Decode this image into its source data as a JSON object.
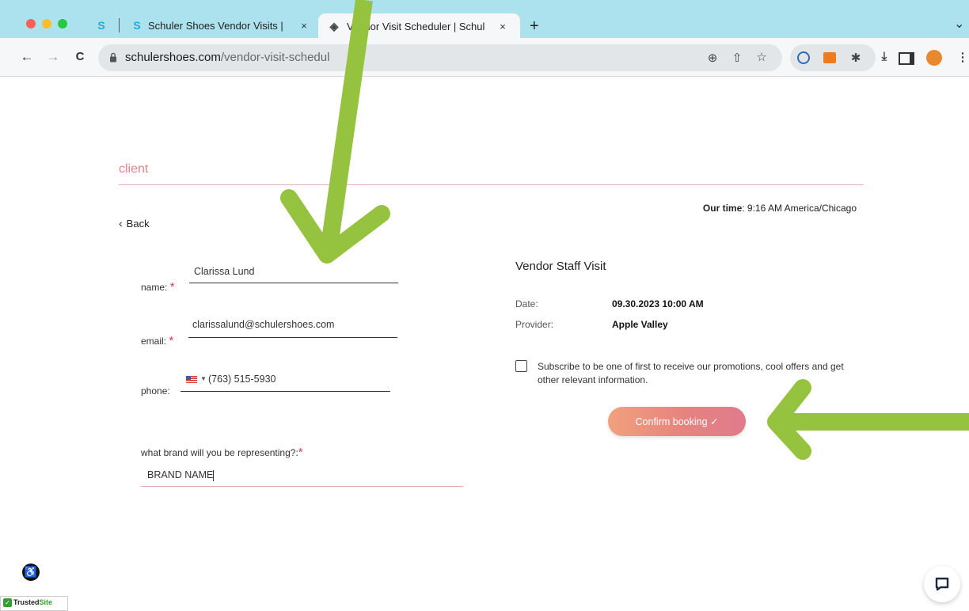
{
  "browser": {
    "tabs": [
      {
        "favicon": "S",
        "title": "",
        "close": ""
      },
      {
        "favicon": "S",
        "title": "Schuler Shoes Vendor Visits |",
        "close": "×"
      },
      {
        "favicon": "◈",
        "title": "Vendor Visit Scheduler | Schul",
        "close": "×"
      }
    ],
    "new_tab": "+",
    "tab_menu": "⌄",
    "nav": {
      "back": "←",
      "forward": "→",
      "reload": "C"
    },
    "url_domain": "schulershoes.com",
    "url_path": "/vendor-visit-schedul"
  },
  "page": {
    "brand": "client",
    "our_time_label": "Our time",
    "our_time_value": ": 9:16 AM America/Chicago",
    "back": "Back",
    "form": {
      "name_label": "name:",
      "name_value": "Clarissa Lund",
      "email_label": "email:",
      "email_value": "clarissalund@schulershoes.com",
      "phone_label": "phone:",
      "phone_value": "(763) 515-5930",
      "brand_label": "what brand will you be representing?:",
      "brand_value": "BRAND NAME",
      "required_mark": "*"
    },
    "summary": {
      "title": "Vendor Staff Visit",
      "date_label": "Date:",
      "date_value": "09.30.2023 10:00 AM",
      "provider_label": "Provider:",
      "provider_value": "Apple Valley"
    },
    "subscribe_text": "Subscribe to be one of first to receive our promotions, cool offers and get other relevant information.",
    "confirm_label": "Confirm booking ✓",
    "trusted_site": "Trusted",
    "trusted_site_suffix": "Site"
  },
  "colors": {
    "tab_bar": "#abe2ee",
    "accent_pink": "#e5838f",
    "annotation_arrow": "#96c33f",
    "required": "#e2374b"
  }
}
